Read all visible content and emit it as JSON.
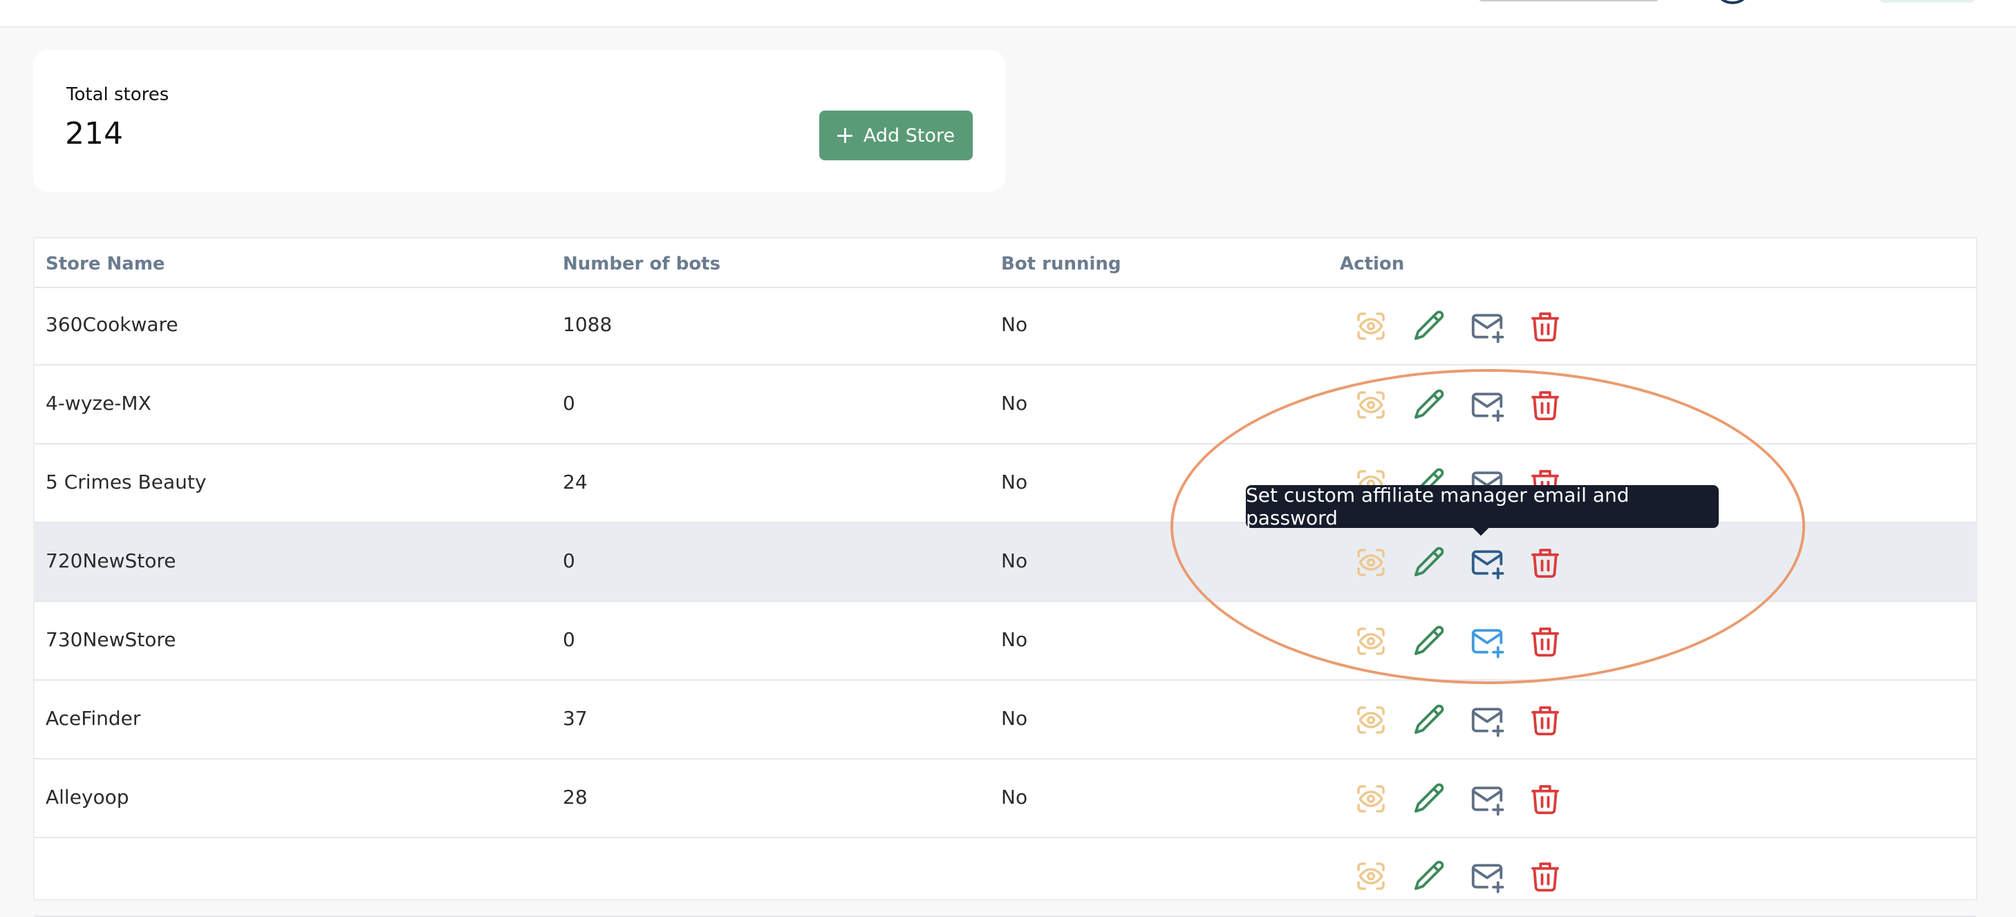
{
  "summary": {
    "label": "Total stores",
    "value": "214",
    "add_button": "Add Store"
  },
  "table": {
    "headers": [
      "Store Name",
      "Number of bots",
      "Bot running",
      "Action"
    ],
    "rows": [
      {
        "name": "360Cookware",
        "bots": "1088",
        "running": "No"
      },
      {
        "name": "4-wyze-MX",
        "bots": "0",
        "running": "No"
      },
      {
        "name": "5 Crimes Beauty",
        "bots": "24",
        "running": "No"
      },
      {
        "name": "720NewStore",
        "bots": "0",
        "running": "No"
      },
      {
        "name": "730NewStore",
        "bots": "0",
        "running": "No"
      },
      {
        "name": "AceFinder",
        "bots": "37",
        "running": "No"
      },
      {
        "name": "Alleyoop",
        "bots": "28",
        "running": "No"
      },
      {
        "name": "",
        "bots": "",
        "running": ""
      }
    ],
    "action_icons": [
      "view-icon",
      "edit-icon",
      "mail-plus-icon",
      "trash-icon"
    ]
  },
  "tooltip": {
    "text": "Set custom affiliate manager email and password"
  },
  "colors": {
    "accent_green": "#5a9b77",
    "view_icon": "#eec890",
    "edit_icon": "#3d8a5c",
    "mail_icon": "#5f6f86",
    "mail_icon_hover": "#2f5c8c",
    "mail_icon_focus": "#3f9be0",
    "delete_icon": "#dc3b3b",
    "highlight_ring": "#ea9b6f"
  }
}
